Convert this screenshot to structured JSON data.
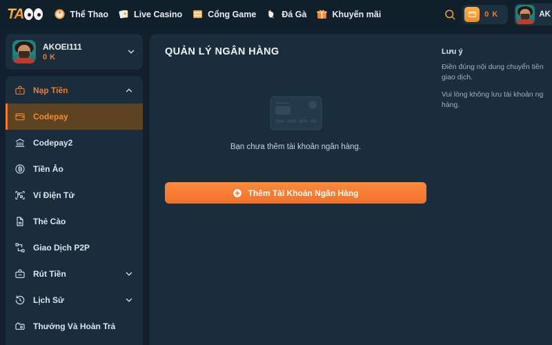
{
  "header": {
    "logo": {
      "text": "TA",
      "suffix": "88"
    },
    "nav": [
      {
        "label": "Thể Thao",
        "icon": "sports-icon"
      },
      {
        "label": "Live Casino",
        "icon": "cards-icon"
      },
      {
        "label": "Cổng Game",
        "icon": "slot-machine-icon"
      },
      {
        "label": "Đá Gà",
        "icon": "rooster-icon"
      },
      {
        "label": "Khuyến mãi",
        "icon": "gift-icon"
      }
    ],
    "search_icon": "search-icon",
    "wallet": {
      "icon": "wallet-icon",
      "amount": "0 K"
    },
    "user": {
      "name": "AK",
      "avatar": "user-avatar"
    }
  },
  "sidebar": {
    "profile": {
      "name": "AKOEI111",
      "balance": "0 K",
      "chevron": "chevron-down-icon"
    },
    "menu": [
      {
        "label": "Nạp Tiền",
        "icon": "deposit-icon",
        "type": "group",
        "expanded": true,
        "chevron": "chevron-up-icon"
      },
      {
        "label": "Codepay",
        "icon": "wallet-icon",
        "type": "sub",
        "active": true
      },
      {
        "label": "Codepay2",
        "icon": "bank-icon",
        "type": "sub",
        "active": false
      },
      {
        "label": "Tiền Ảo",
        "icon": "bitcoin-icon",
        "type": "sub",
        "active": false
      },
      {
        "label": "Ví Điện Tử",
        "icon": "qr-icon",
        "type": "sub",
        "active": false
      },
      {
        "label": "Thẻ Cào",
        "icon": "prepaid-card-icon",
        "type": "sub",
        "active": false
      },
      {
        "label": "Giao Dịch P2P",
        "icon": "p2p-icon",
        "type": "sub",
        "active": false
      },
      {
        "label": "Rút Tiền",
        "icon": "withdraw-icon",
        "type": "group",
        "expanded": false,
        "chevron": "chevron-down-icon"
      },
      {
        "label": "Lịch Sử",
        "icon": "history-icon",
        "type": "group",
        "expanded": false,
        "chevron": "chevron-down-icon"
      },
      {
        "label": "Thưởng Và Hoàn Trả",
        "icon": "reward-icon",
        "type": "group",
        "expanded": false
      }
    ]
  },
  "main": {
    "title": "QUẢN LÝ NGÂN HÀNG",
    "empty_state": {
      "illustration": "bank-card-illustration",
      "text": "Bạn chưa thêm tài khoản ngân hàng."
    },
    "add_button": {
      "label": "Thêm Tài Khoản Ngân Hàng",
      "icon": "plus-circle-icon"
    },
    "notes": {
      "title": "Lưu ý",
      "lines": [
        "Điền đúng nội dung chuyển tiền",
        "giao dịch.",
        "Vui lòng không lưu tài khoản ng",
        "hàng."
      ]
    }
  },
  "colors": {
    "accent": "#f47b28",
    "panel": "#1a2d3c",
    "page_bg": "#11202c",
    "active_row": "#5d431f"
  }
}
